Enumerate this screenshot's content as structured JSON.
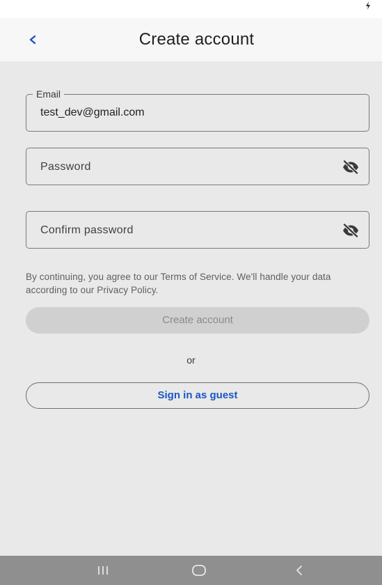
{
  "header": {
    "title": "Create account"
  },
  "form": {
    "email": {
      "label": "Email",
      "value": "test_dev@gmail.com"
    },
    "password": {
      "placeholder": "Password"
    },
    "confirm_password": {
      "placeholder": "Confirm password"
    },
    "terms": "By continuing, you agree to our Terms of Service. We'll handle your data according to our Privacy Policy.",
    "create_label": "Create account",
    "or_label": "or",
    "guest_label": "Sign in as guest"
  },
  "colors": {
    "accent": "#1a56c4",
    "background": "#e9e9e9",
    "disabled_button": "#d0d0d0",
    "nav_bar": "#8f8f8f"
  },
  "icons": {
    "back": "chevron-left-icon",
    "password_visibility": "eye-off-icon",
    "status": "charging-icon",
    "nav_recent": "recent-apps-icon",
    "nav_home": "home-icon",
    "nav_back": "nav-back-icon"
  }
}
